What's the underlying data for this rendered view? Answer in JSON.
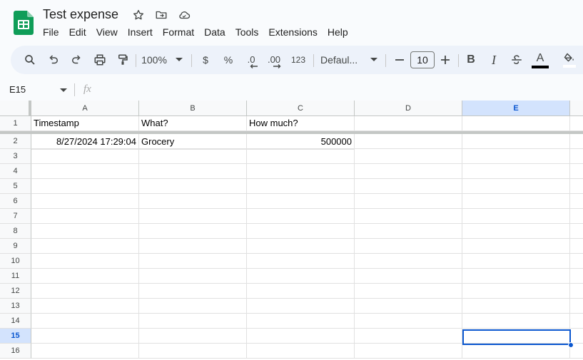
{
  "document": {
    "title": "Test expense"
  },
  "menu": [
    "File",
    "Edit",
    "View",
    "Insert",
    "Format",
    "Data",
    "Tools",
    "Extensions",
    "Help"
  ],
  "toolbar": {
    "zoom": "100%",
    "currency_label": "$",
    "percent_label": "%",
    "decrease_decimal_label": ".0",
    "increase_decimal_label": ".00",
    "number_format_label": "123",
    "font_name": "Defaul...",
    "font_size": "10",
    "bold_label": "B",
    "italic_label": "I",
    "text_color_label": "A"
  },
  "formula_bar": {
    "name_box": "E15",
    "fx_label": "fx",
    "formula": ""
  },
  "sheet": {
    "columns": [
      "A",
      "B",
      "C",
      "D",
      "E"
    ],
    "rows": [
      "1",
      "2",
      "3",
      "4",
      "5",
      "6",
      "7",
      "8",
      "9",
      "10",
      "11",
      "12",
      "13",
      "14",
      "15",
      "16"
    ],
    "cells": {
      "A1": "Timestamp",
      "B1": "What?",
      "C1": "How much?",
      "A2": "8/27/2024 17:29:04",
      "B2": "Grocery",
      "C2": "500000"
    },
    "selected_cell": "E15",
    "selected_column": "E",
    "selected_row": "15"
  },
  "colors": {
    "accent": "#0b57d0",
    "toolbar_bg": "#edf2fa",
    "sheets_green": "#0f9d58",
    "selection_header": "#d3e3fd"
  },
  "icons": {
    "logo": "google-sheets-logo",
    "star": "star-icon",
    "move": "move-to-folder-icon",
    "cloud": "cloud-saved-icon",
    "search": "search-icon",
    "undo": "undo-icon",
    "redo": "redo-icon",
    "print": "print-icon",
    "paint_format": "paint-format-icon",
    "strikethrough": "strikethrough-icon",
    "fill_color": "fill-color-icon"
  }
}
